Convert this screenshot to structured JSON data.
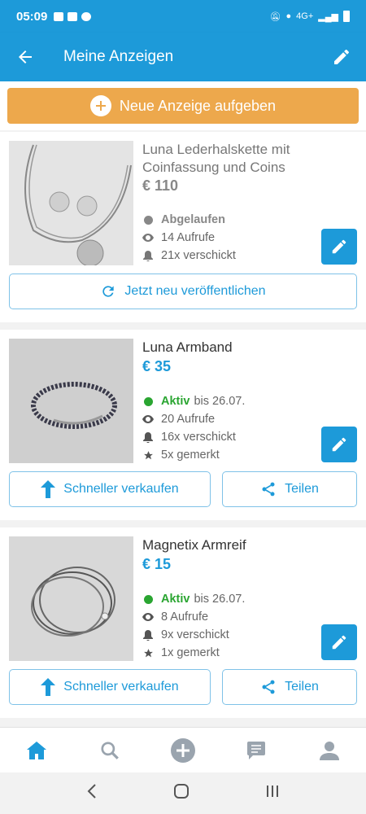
{
  "status_bar": {
    "time": "05:09",
    "network": "4G+"
  },
  "header": {
    "title": "Meine Anzeigen"
  },
  "new_ad_button": {
    "label": "Neue Anzeige aufgeben"
  },
  "ads": [
    {
      "title": "Luna Lederhalskette mit Coinfassung und Coins",
      "price": "€ 110",
      "status": "Abgelaufen",
      "status_suffix": "",
      "views": "14 Aufrufe",
      "sent": "21x verschickt",
      "action_label": "Jetzt neu veröffentlichen"
    },
    {
      "title": "Luna Armband",
      "price": "€ 35",
      "status": "Aktiv",
      "status_suffix": "bis 26.07.",
      "views": "20 Aufrufe",
      "sent": "16x verschickt",
      "saved": "5x gemerkt",
      "sell_faster_label": "Schneller verkaufen",
      "share_label": "Teilen"
    },
    {
      "title": "Magnetix Armreif",
      "price": "€ 15",
      "status": "Aktiv",
      "status_suffix": "bis 26.07.",
      "views": "8 Aufrufe",
      "sent": "9x verschickt",
      "saved": "1x gemerkt",
      "sell_faster_label": "Schneller verkaufen",
      "share_label": "Teilen"
    }
  ],
  "bottom_nav": [
    "home-icon",
    "search-icon",
    "add-icon",
    "messages-icon",
    "profile-icon"
  ],
  "colors": {
    "primary": "#1d9ad9",
    "accent": "#eda84c",
    "active": "#2aa531",
    "expired": "#888888"
  }
}
